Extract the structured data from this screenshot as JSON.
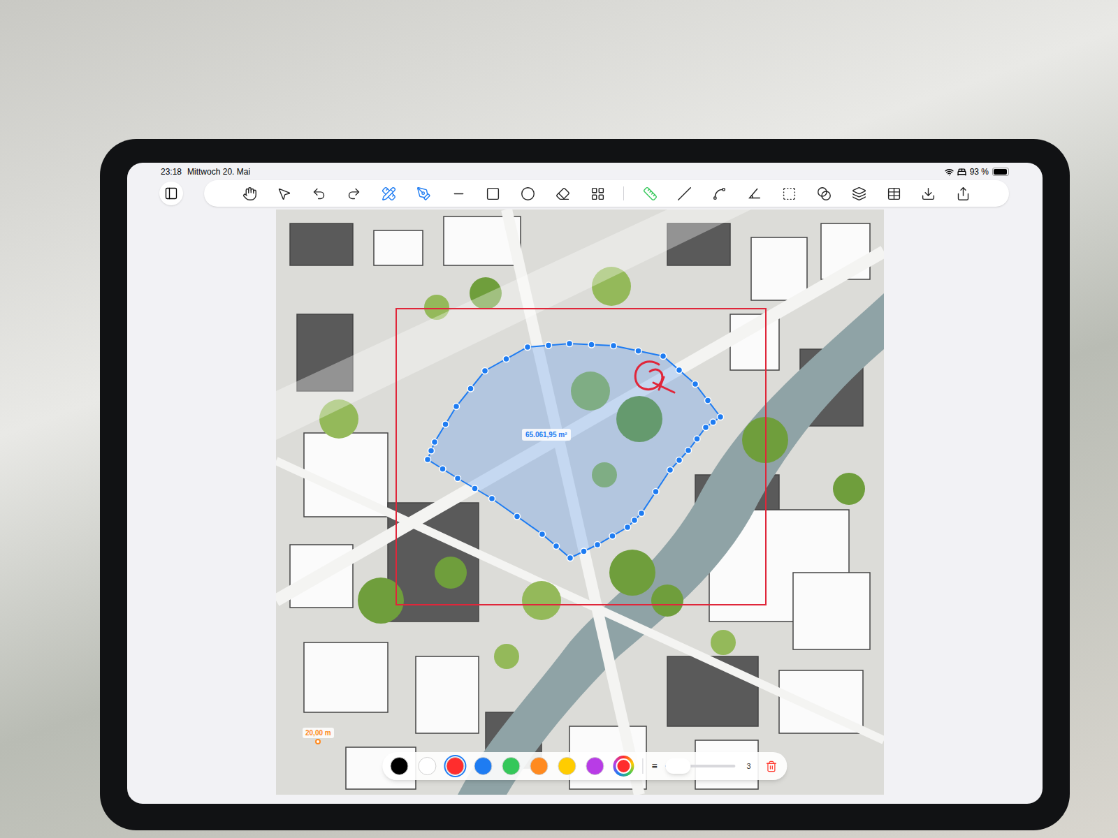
{
  "status_bar": {
    "time": "23:18",
    "date": "Mittwoch 20. Mai",
    "battery": "93 %",
    "battery_level": 0.93,
    "wifi": true,
    "sleep_focus": true
  },
  "toolbar": {
    "sidebar_toggle": {
      "selected": false
    },
    "tools": [
      {
        "kind": "hand",
        "selected": false
      },
      {
        "kind": "select",
        "selected": false
      },
      {
        "kind": "undo",
        "selected": false
      },
      {
        "kind": "redo",
        "selected": false
      },
      {
        "kind": "ruler-pencil",
        "selected": true
      },
      {
        "kind": "pen",
        "selected": true
      },
      {
        "kind": "line",
        "selected": false
      },
      {
        "kind": "rectangle",
        "selected": false
      },
      {
        "kind": "circle",
        "selected": false
      },
      {
        "kind": "eraser",
        "selected": false
      },
      {
        "kind": "grid",
        "selected": false
      },
      {
        "kind": "separator",
        "selected": false
      },
      {
        "kind": "scale",
        "selected": false
      },
      {
        "kind": "distance",
        "selected": false
      },
      {
        "kind": "polyline",
        "selected": false
      },
      {
        "kind": "angle",
        "selected": false
      },
      {
        "kind": "area-select",
        "selected": false
      },
      {
        "kind": "overlap",
        "selected": false
      },
      {
        "kind": "layers",
        "selected": false
      },
      {
        "kind": "table",
        "selected": false
      },
      {
        "kind": "import",
        "selected": false
      },
      {
        "kind": "share",
        "selected": false
      }
    ]
  },
  "canvas": {
    "area": {
      "label": "65.061,95 m²"
    },
    "scale": {
      "label": "20,00 m"
    }
  },
  "palette": {
    "colors": [
      {
        "color": "#000000",
        "selected": false
      },
      {
        "color": "#ffffff",
        "selected": false
      },
      {
        "color": "#ff2d2d",
        "selected": true
      },
      {
        "color": "#1e7cf2",
        "selected": false
      },
      {
        "color": "#34c759",
        "selected": false
      },
      {
        "color": "#ff8a1f",
        "selected": false
      },
      {
        "color": "#ffcc00",
        "selected": false
      },
      {
        "color": "#b83ce6",
        "selected": false
      }
    ],
    "custom": {
      "color": "#ff2d2d",
      "selected": false
    }
  },
  "stroke": {
    "icon": "≡",
    "value": "3",
    "level": 0.12
  }
}
